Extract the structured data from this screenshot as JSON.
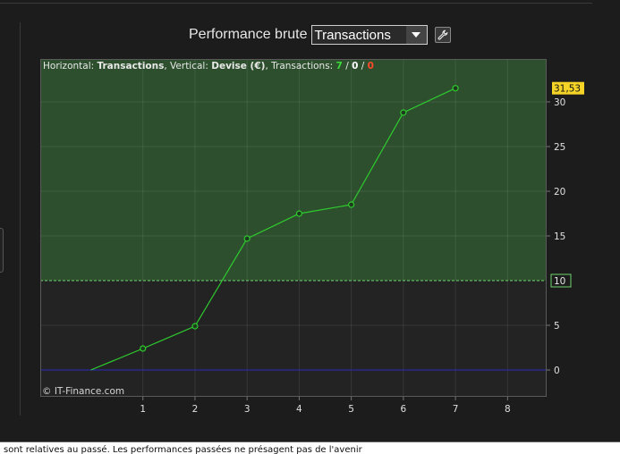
{
  "header": {
    "title": "Performance brute",
    "mode_select_value": "Transactions"
  },
  "info": {
    "prefix_horizontal": "Horizontal: ",
    "horizontal_value": "Transactions",
    "prefix_vertical": ", Vertical: ",
    "vertical_value": "Devise (€)",
    "prefix_transactions": ", Transactions: ",
    "count_green": "7",
    "sep1": " / ",
    "count_white": "0",
    "sep2": " / ",
    "count_red": "0"
  },
  "watermark": "© IT-Finance.com",
  "footer_text": "sont relatives au passé. Les performances passées ne présagent pas de l'avenir",
  "colors": {
    "profit_zone": "#2d4f2e",
    "line": "#2ecc2e",
    "zero_line": "#2b2bbf",
    "threshold_line": "#6fd46f",
    "last_value_badge": "#f5d327",
    "count_green": "#3ddc3d",
    "count_red": "#ff4b2b"
  },
  "chart_data": {
    "type": "line",
    "x": [
      0,
      1,
      2,
      3,
      4,
      5,
      6,
      7
    ],
    "y": [
      0,
      2.4,
      4.9,
      14.7,
      17.5,
      18.5,
      28.8,
      31.53
    ],
    "markers": [
      false,
      true,
      true,
      true,
      true,
      true,
      true,
      true
    ],
    "xlim": [
      -0.97,
      8.75
    ],
    "ylim": [
      -3.0,
      34.8
    ],
    "x_ticks": [
      1,
      2,
      3,
      4,
      5,
      6,
      7,
      8
    ],
    "x_tick_labels": [
      "1",
      "2",
      "3",
      "4",
      "5",
      "6",
      "7",
      "8"
    ],
    "y_ticks": [
      0,
      5,
      15,
      20,
      25,
      30
    ],
    "y_tick_labels": [
      "0",
      "5",
      "15",
      "20",
      "25",
      "30"
    ],
    "threshold": {
      "value": 10,
      "label": "10"
    },
    "last_value": {
      "value": 31.53,
      "label": "31,53"
    },
    "grid": true
  }
}
